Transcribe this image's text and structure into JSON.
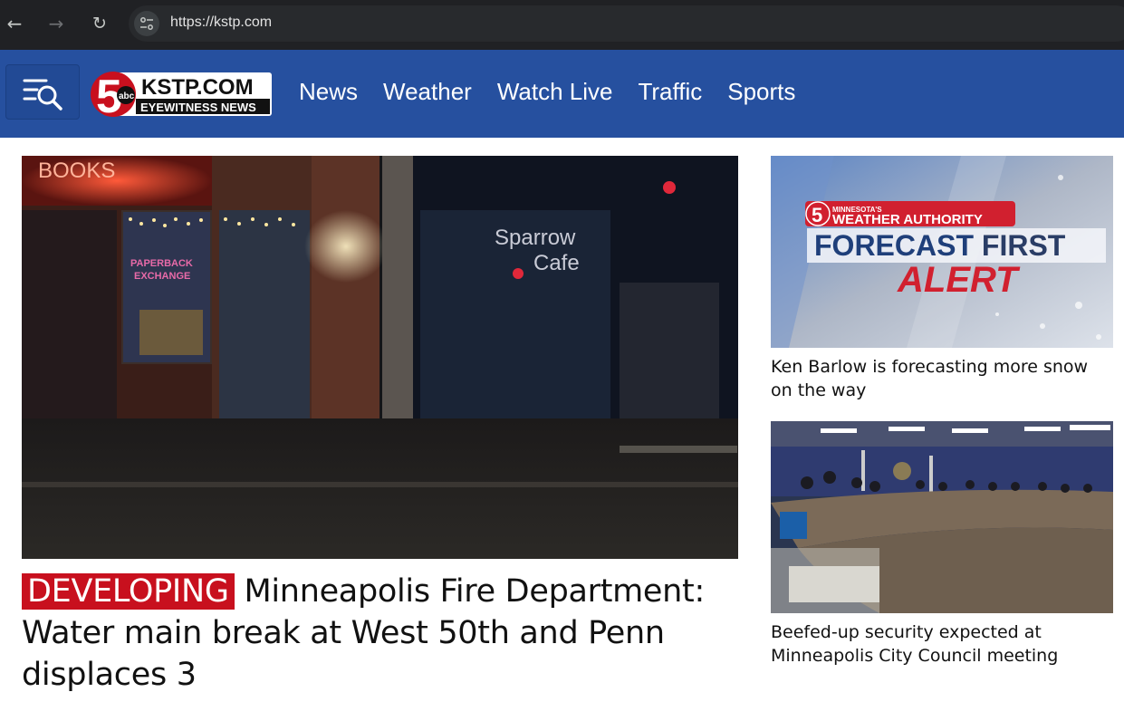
{
  "browser": {
    "url": "https://kstp.com",
    "back_icon": "arrow-left",
    "forward_icon": "arrow-right",
    "reload_icon": "reload"
  },
  "header": {
    "background": "#26509f",
    "logo": {
      "number": "5",
      "network": "abc",
      "site": "KSTP.COM",
      "tagline": "EYEWITNESS NEWS"
    },
    "nav": [
      "News",
      "Weather",
      "Watch Live",
      "Traffic",
      "Sports"
    ]
  },
  "main_story": {
    "tag": "DEVELOPING",
    "title": "Minneapolis Fire Department: Water main break at West 50th and Penn displaces 3",
    "image_signs": [
      "BOOKS",
      "Sparrow",
      "Cafe",
      "PAPERBACK",
      "EXCHANGE"
    ]
  },
  "side_stories": [
    {
      "title": "Ken Barlow is forecasting more snow on the way",
      "image_text": {
        "kicker": "MINNESOTA'S",
        "brand": "WEATHER AUTHORITY",
        "line1a": "FORECAST ",
        "line1b": "FIRST",
        "line2": "ALERT"
      }
    },
    {
      "title": "Beefed-up security expected at Minneapolis City Council meeting"
    }
  ]
}
